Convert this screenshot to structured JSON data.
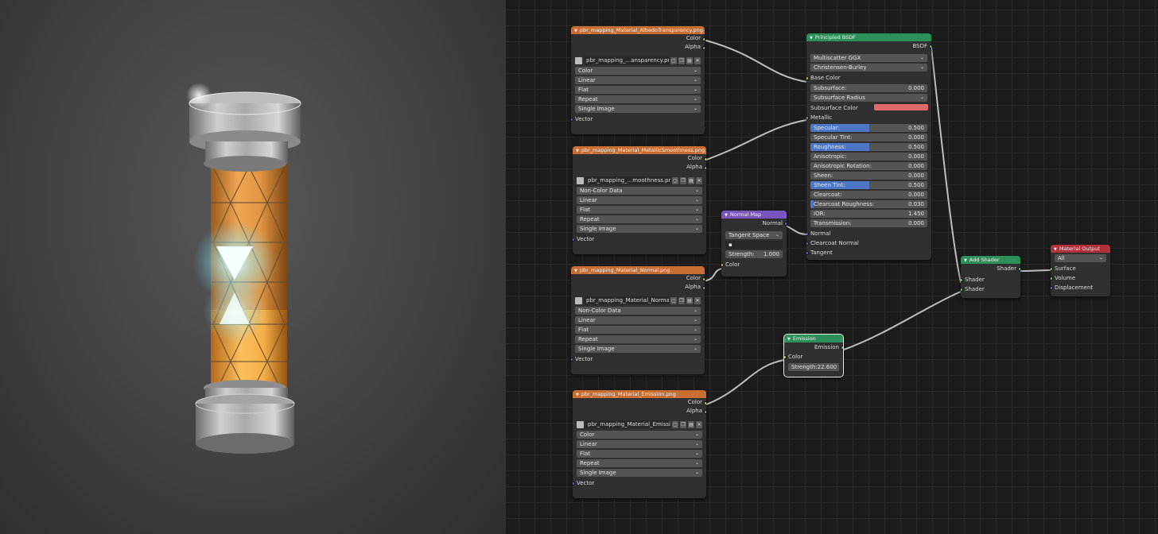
{
  "textures": [
    {
      "title": "pbr_mapping_Material_AlbedoTransparency.png",
      "image": "pbr_mapping_...ansparency.png",
      "outputs": [
        "Color",
        "Alpha"
      ],
      "options": [
        "Color",
        "Linear",
        "Flat",
        "Repeat",
        "Single Image"
      ],
      "input": "Vector"
    },
    {
      "title": "pbr_mapping_Material_MetallicSmoothness.png",
      "image": "pbr_mapping_...moothness.png",
      "outputs": [
        "Color",
        "Alpha"
      ],
      "options": [
        "Non-Color Data",
        "Linear",
        "Flat",
        "Repeat",
        "Single Image"
      ],
      "input": "Vector"
    },
    {
      "title": "pbr_mapping_Material_Normal.png",
      "image": "pbr_mapping_Material_Normal...",
      "outputs": [
        "Color",
        "Alpha"
      ],
      "options": [
        "Non-Color Data",
        "Linear",
        "Flat",
        "Repeat",
        "Single Image"
      ],
      "input": "Vector"
    },
    {
      "title": "pbr_mapping_Material_Emission.png",
      "image": "pbr_mapping_Material_Emissio...",
      "outputs": [
        "Color",
        "Alpha"
      ],
      "options": [
        "Color",
        "Linear",
        "Flat",
        "Repeat",
        "Single Image"
      ],
      "input": "Vector"
    }
  ],
  "bsdf": {
    "title": "Principled BSDF",
    "output": "BSDF",
    "dist": "Multiscatter GGX",
    "sss": "Christensen-Burley",
    "base_color": "Base Color",
    "subsurface": {
      "label": "Subsurface:",
      "value": "0.000"
    },
    "subsurface_radius": "Subsurface Radius",
    "subsurface_color": "Subsurface Color",
    "metallic": "Metallic",
    "sliders": [
      {
        "label": "Specular:",
        "value": "0.500",
        "fill": 0.5
      },
      {
        "label": "Specular Tint:",
        "value": "0.000",
        "fill": 0
      },
      {
        "label": "Roughness:",
        "value": "0.500",
        "fill": 0.5
      },
      {
        "label": "Anisotropic:",
        "value": "0.000",
        "fill": 0
      },
      {
        "label": "Anisotropic Rotation:",
        "value": "0.000",
        "fill": 0
      },
      {
        "label": "Sheen:",
        "value": "0.000",
        "fill": 0
      },
      {
        "label": "Sheen Tint:",
        "value": "0.500",
        "fill": 0.5
      },
      {
        "label": "Clearcoat:",
        "value": "0.000",
        "fill": 0
      },
      {
        "label": "Clearcoat Roughness:",
        "value": "0.030",
        "fill": 0.03
      },
      {
        "label": "IOR:",
        "value": "1.450",
        "fill": 0
      },
      {
        "label": "Transmission:",
        "value": "0.000",
        "fill": 0
      }
    ],
    "inputs": [
      "Normal",
      "Clearcoat Normal",
      "Tangent"
    ]
  },
  "normal_map": {
    "title": "Normal Map",
    "output": "Normal",
    "space": "Tangent Space",
    "strength_label": "Strength:",
    "strength_value": "1.000",
    "input": "Color"
  },
  "emission": {
    "title": "Emission",
    "output": "Emission",
    "input": "Color",
    "strength": "Strength:22.600"
  },
  "add_shader": {
    "title": "Add Shader",
    "output": "Shader",
    "inputs": [
      "Shader",
      "Shader"
    ]
  },
  "material_output": {
    "title": "Material Output",
    "target": "All",
    "inputs": [
      "Surface",
      "Volume",
      "Displacement"
    ]
  },
  "colors": {
    "texture_header": "#c86e32",
    "shader_header": "#2d8f5a",
    "vector_header": "#7a55c0",
    "output_header": "#b0303c",
    "slider_fill": "#4c77c9",
    "subsurface_swatch": "#e06a6a"
  }
}
